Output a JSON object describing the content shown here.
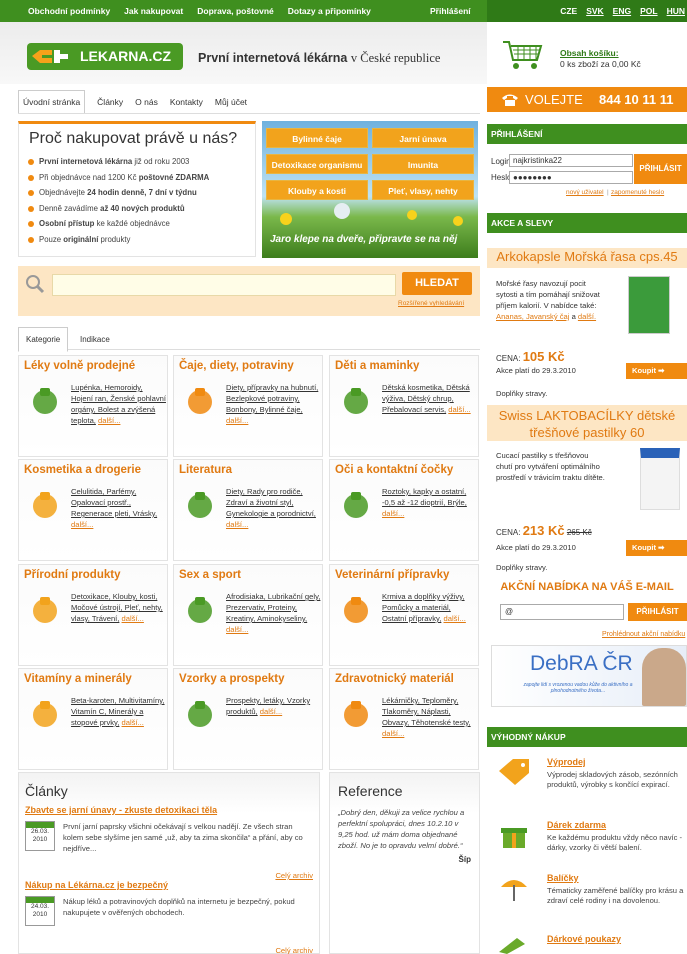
{
  "topnav": {
    "items": [
      "Obchodní podmínky",
      "Jak nakupovat",
      "Doprava, poštovné",
      "Dotazy a připomínky"
    ],
    "login": "Přihlášení",
    "langs": [
      "CZE",
      "SVK",
      "ENG",
      "POL",
      "HUN"
    ]
  },
  "header": {
    "logo": "LEKARNA.CZ",
    "slogan_bold": "První internetová lékárna",
    "slogan_rest": "v České republice"
  },
  "cart": {
    "title": "Obsah košíku:",
    "summary": "0 ks zboží za 0,00 Kč"
  },
  "phone": {
    "label": "VOLEJTE",
    "number": "844 10 11 11"
  },
  "tabs": [
    "Úvodní stránka",
    "Články",
    "O nás",
    "Kontakty",
    "Můj účet"
  ],
  "why": {
    "title": "Proč nakupovat právě u nás?",
    "items": [
      {
        "b": "První internetová lékárna",
        "t": " již od roku 2003"
      },
      {
        "t": "Při objednávce nad 1200 Kč ",
        "b": "poštovné ZDARMA"
      },
      {
        "t": "Objednávejte ",
        "b": "24 hodin denně, 7 dní v týdnu"
      },
      {
        "t": "Denně zavádíme ",
        "b": "až 40 nových produktů"
      },
      {
        "b": "Osobní přístup",
        "t": " ke každé objednávce"
      },
      {
        "t": "Pouze ",
        "b": "originální",
        "t2": " produkty"
      }
    ]
  },
  "promo": {
    "buttons": [
      "Bylinné čaje",
      "Jarní únava",
      "Detoxikace organismu",
      "Imunita",
      "Klouby a kosti",
      "Pleť, vlasy, nehty"
    ],
    "slogan": "Jaro klepe na dveře, připravte se na něj"
  },
  "search": {
    "button": "HLEDAT",
    "advanced": "Rozšířené vyhledávání"
  },
  "cattabs": [
    "Kategorie",
    "Indikace"
  ],
  "categories": [
    {
      "title": "Léky volně prodejné",
      "links": "Lupénka, Hemoroidy, Hojení ran, Ženské pohlavní orgány, Bolest a zvýšená teplota,",
      "more": "další..."
    },
    {
      "title": "Čaje, diety, potraviny",
      "links": "Diety, přípravky na hubnutí, Bezlepkové potraviny, Bonbony, Bylinné čaje,",
      "more": "další..."
    },
    {
      "title": "Děti a maminky",
      "links": "Dětská kosmetika, Dětská výživa, Dětský chrup, Přebalovací servis,",
      "more": "další..."
    },
    {
      "title": "Kosmetika a drogerie",
      "links": "Celulitida, Parfémy, Opalovací prostř., Regenerace pleti, Vrásky,",
      "more": "další..."
    },
    {
      "title": "Literatura",
      "links": "Diety, Rady pro rodiče, Zdraví a životní styl, Gynekologie a porodnictví,",
      "more": "další..."
    },
    {
      "title": "Oči a kontaktní čočky",
      "links": "Roztoky, kapky a ostatní, -0,5 až -12 dioptrií, Brýle,",
      "more": "další..."
    },
    {
      "title": "Přírodní produkty",
      "links": "Detoxikace, Klouby, kosti, Močové ústrojí, Pleť, nehty, vlasy, Trávení,",
      "more": "další..."
    },
    {
      "title": "Sex a sport",
      "links": "Afrodisiaka, Lubrikační gely, Prezervativ, Proteiny, Kreatiny, Aminokyseliny,",
      "more": "další..."
    },
    {
      "title": "Veterinární přípravky",
      "links": "Krmiva a doplňky výživy, Pomůcky a materiál, Ostatní přípravky,",
      "more": "další..."
    },
    {
      "title": "Vitamíny a minerály",
      "links": "Beta-karoten, Multivitamíny, Vitamín C, Minerály a stopové prvky,",
      "more": "další..."
    },
    {
      "title": "Vzorky a prospekty",
      "links": "Prospekty, letáky, Vzorky produktů,",
      "more": "další..."
    },
    {
      "title": "Zdravotnický materiál",
      "links": "Lékárničky, Teploměry, Tlakoměry, Náplasti, Obvazy, Těhotenské testy,",
      "more": "další..."
    }
  ],
  "articles": {
    "title": "Články",
    "items": [
      {
        "title": "Zbavte se jarní únavy - zkuste detoxikaci těla",
        "date1": "26.03.",
        "date2": "2010",
        "text": "První jarní paprsky všichni očekávají s velkou nadějí. Ze všech stran kolem sebe slyšíme jen samé „už, aby ta zima skončila“ a přání, aby co nejdříve...",
        "link": "Celý archiv"
      },
      {
        "title": "Nákup na Lékárna.cz je bezpečný",
        "date1": "24.03.",
        "date2": "2010",
        "text": "Nákup léků a potravinových doplňků na internetu je bezpečný, pokud nakupujete v ověřených obchodech.",
        "link": "Celý archiv"
      }
    ]
  },
  "reference": {
    "title": "Reference",
    "quote": "„Dobrý den, děkuji za velice rychlou a perfektní spolupráci, dnes 10.2.10 v 9,25 hod. už mám doma objednané zboží. No je to opravdu velmí dobré.“",
    "sign": "Šíp"
  },
  "login": {
    "header": "PŘIHLÁŠENÍ",
    "login_label": "Login:",
    "login_value": "najkristinka22",
    "pass_label": "Heslo:",
    "pass_value": "●●●●●●●●",
    "button": "PŘIHLÁSIT",
    "new_user": "nový uživatel",
    "forgot": "zapomenuté heslo"
  },
  "akce": {
    "header": "AKCE A SLEVY",
    "p1": {
      "title": "Arkokapsle Mořská řasa cps.45",
      "desc": "Mořské řasy navozují pocit sytosti a tím pomáhají snižovat příjem kalorií. V nabídce také: ",
      "links": "Ananas, Javanský čaj",
      "and": " a ",
      "last": "další.",
      "price_label": "CENA:",
      "price": "105 Kč",
      "valid": "Akce platí do 29.3.2010",
      "cat": "Doplňky stravy.",
      "buy": "Koupit"
    },
    "p2": {
      "title": "Swiss LAKTOBACÍLKY dětské třešňové pastilky 60",
      "desc": "Cucací pastilky s třešňovou chutí pro vytváření optimálního prostředí v trávicím traktu dítěte.",
      "price_label": "CENA:",
      "price": "213 Kč",
      "old": "265 Kč",
      "valid": "Akce platí do 29.3.2010",
      "cat": "Doplňky stravy.",
      "buy": "Koupit"
    },
    "email_title": "AKČNÍ NABÍDKA NA VÁŠ E-MAIL",
    "email_value": "@",
    "email_btn": "PŘIHLÁSIT",
    "view": "Prohlédnout akční nabídku",
    "debra": {
      "title": "DebRA ČR",
      "sub": "zapojte lidi s vrozenou vadou kůže do aktivního a plnohodnotného života..."
    }
  },
  "vyhodny": {
    "header": "VÝHODNÝ NÁKUP",
    "items": [
      {
        "title": "Výprodej",
        "desc": "Výprodej skladových zásob, sezónních produktů, výrobky s končící expirací."
      },
      {
        "title": "Dárek zdarma",
        "desc": "Ke každému produktu vždy něco navíc - dárky, vzorky či větší balení."
      },
      {
        "title": "Balíčky",
        "desc": "Tématicky zaměřené balíčky pro krásu a zdraví celé rodiny i na dovolenou."
      },
      {
        "title": "Dárkové poukazy",
        "desc": ""
      }
    ]
  },
  "colors": {
    "green": "#3f8f1f",
    "orange": "#f08a10",
    "link": "#e07a12"
  }
}
